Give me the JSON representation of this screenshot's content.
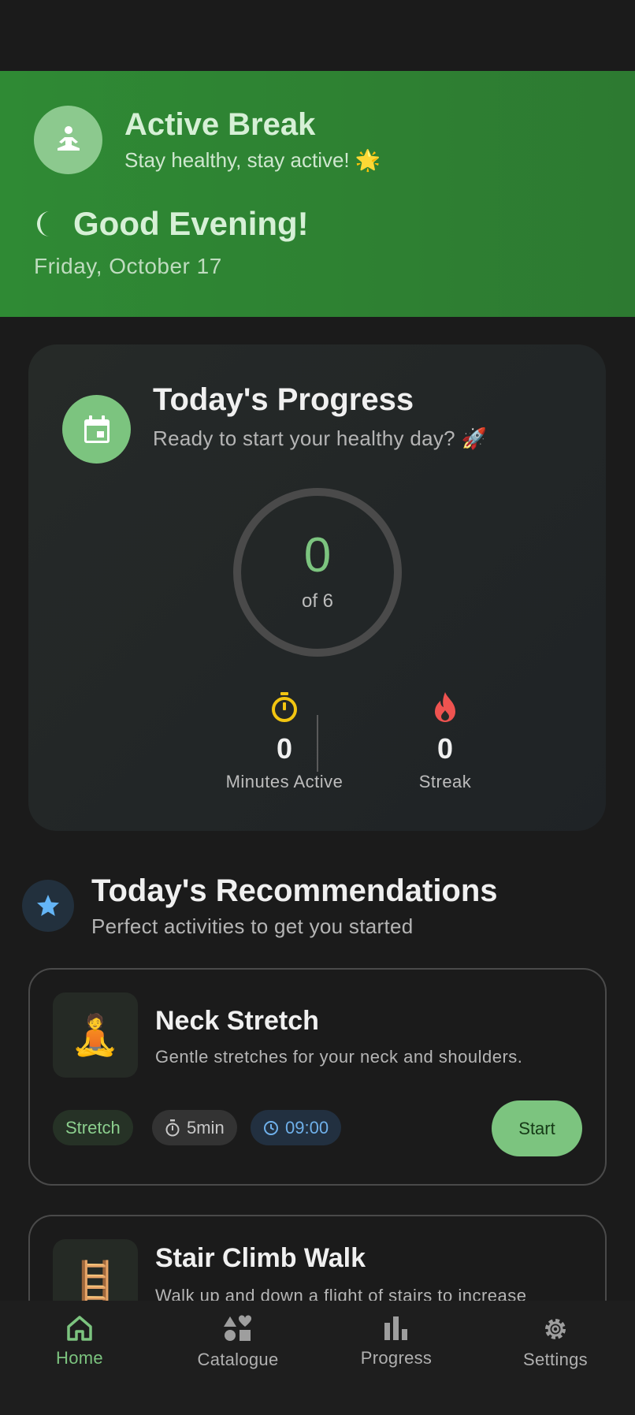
{
  "header": {
    "app_title": "Active Break",
    "app_subtitle": "Stay healthy, stay active! 🌟",
    "greeting": "Good Evening!",
    "date": "Friday, October 17"
  },
  "progress": {
    "title": "Today's Progress",
    "subtitle": "Ready to start your healthy day? 🚀",
    "completed": "0",
    "of_label": "of 6",
    "minutes_value": "0",
    "minutes_label": "Minutes Active",
    "streak_value": "0",
    "streak_label": "Streak"
  },
  "recommendations": {
    "title": "Today's Recommendations",
    "subtitle": "Perfect activities to get you started",
    "items": [
      {
        "emoji": "🧘",
        "title": "Neck Stretch",
        "description": "Gentle stretches for your neck and shoulders.",
        "category": "Stretch",
        "duration": "5min",
        "time": "09:00",
        "button": "Start"
      },
      {
        "emoji": "🪜",
        "title": "Stair Climb Walk",
        "description": "Walk up and down a flight of stairs to increase"
      }
    ]
  },
  "nav": {
    "items": [
      {
        "label": "Home",
        "icon": "home-icon"
      },
      {
        "label": "Catalogue",
        "icon": "catalogue-icon"
      },
      {
        "label": "Progress",
        "icon": "bar-chart-icon"
      },
      {
        "label": "Settings",
        "icon": "gear-icon"
      }
    ],
    "active": "Home"
  },
  "colors": {
    "accent": "#7cc47f",
    "header_bg": "#2e7d32",
    "background": "#1b1b1b",
    "timer": "#f2c511",
    "streak": "#ef5350",
    "star": "#64b5f6"
  }
}
